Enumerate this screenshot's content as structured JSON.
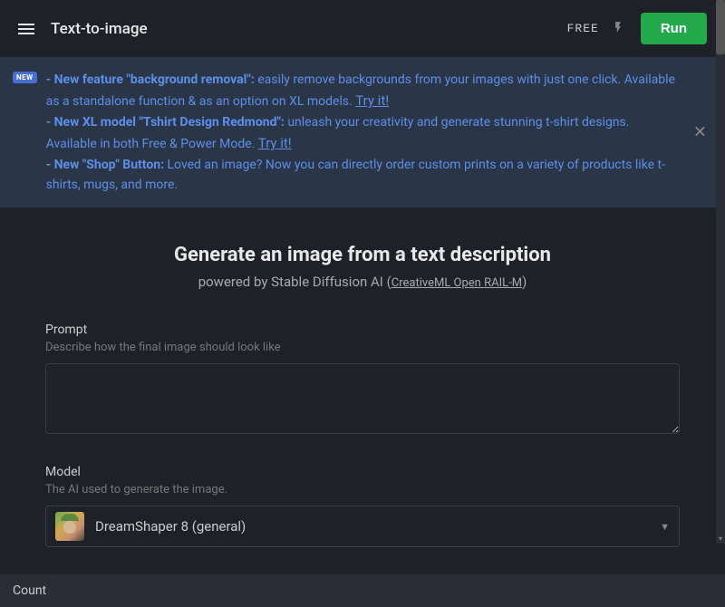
{
  "header": {
    "title": "Text-to-image",
    "free_label": "FREE",
    "run_label": "Run"
  },
  "banner": {
    "badge": "NEW",
    "item1_bold": "- New feature \"background removal\":",
    "item1_text": " easily remove backgrounds from your images with just one click. Available as a standalone function & as an option on XL models. ",
    "item1_link": "Try it!",
    "item2_bold": "- New XL model \"Tshirt Design Redmond\":",
    "item2_text": " unleash your creativity and generate stunning t-shirt designs. Available in both Free & Power Mode. ",
    "item2_link": "Try it!",
    "item3_bold": "- New \"Shop\" Button:",
    "item3_text": " Loved an image? Now you can directly order custom prints on a variety of products like t-shirts, mugs, and more."
  },
  "main": {
    "title": "Generate an image from a text description",
    "subtitle_prefix": "powered by Stable Diffusion AI (",
    "subtitle_license": "CreativeML Open RAIL-M",
    "subtitle_suffix": ")",
    "prompt": {
      "label": "Prompt",
      "hint": "Describe how the final image should look like",
      "value": ""
    },
    "model": {
      "label": "Model",
      "hint": "The AI used to generate the image.",
      "selected": "DreamShaper 8 (general)"
    },
    "count": {
      "label": "Count"
    }
  }
}
